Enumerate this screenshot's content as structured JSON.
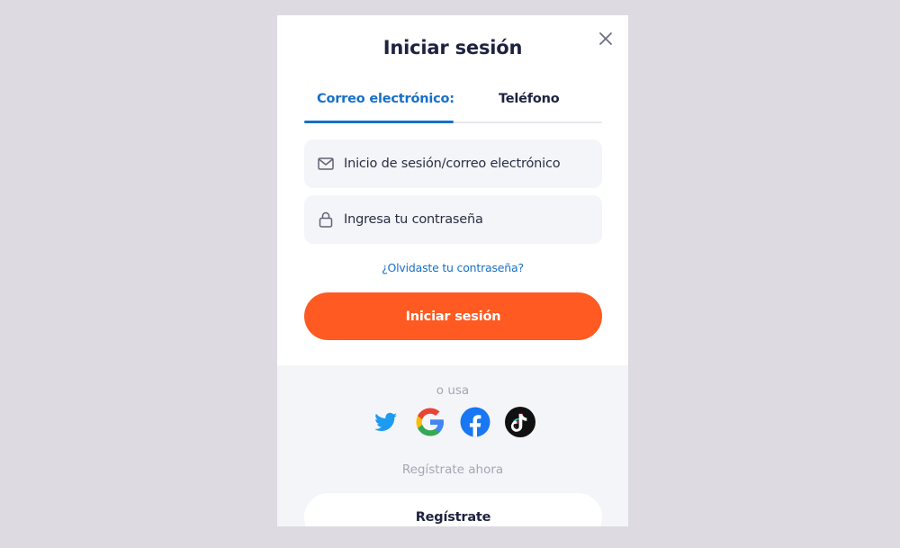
{
  "modal": {
    "title": "Iniciar sesión",
    "close_icon": "close-icon"
  },
  "tabs": [
    {
      "label": "Correo electrónico:",
      "active": true
    },
    {
      "label": "Teléfono",
      "active": false
    }
  ],
  "form": {
    "email": {
      "placeholder": "Inicio de sesión/correo electrónico",
      "value": "",
      "icon": "mail-icon"
    },
    "password": {
      "placeholder": "Ingresa tu contraseña",
      "value": "",
      "icon": "lock-icon"
    },
    "forgot_link": "¿Olvidaste tu contraseña?",
    "submit_label": "Iniciar sesión"
  },
  "social": {
    "or_use": "o usa",
    "providers": [
      {
        "name": "Twitter",
        "icon": "twitter-icon"
      },
      {
        "name": "Google",
        "icon": "google-icon"
      },
      {
        "name": "Facebook",
        "icon": "facebook-icon"
      },
      {
        "name": "TikTok",
        "icon": "tiktok-icon"
      }
    ],
    "register_prompt": "Regístrate ahora",
    "register_label": "Regístrate"
  },
  "colors": {
    "accent_blue": "#1770c8",
    "primary_orange": "#fe5a22",
    "backdrop": "#dddbe1",
    "panel_gray": "#f4f5f8",
    "heading": "#1e2340"
  }
}
